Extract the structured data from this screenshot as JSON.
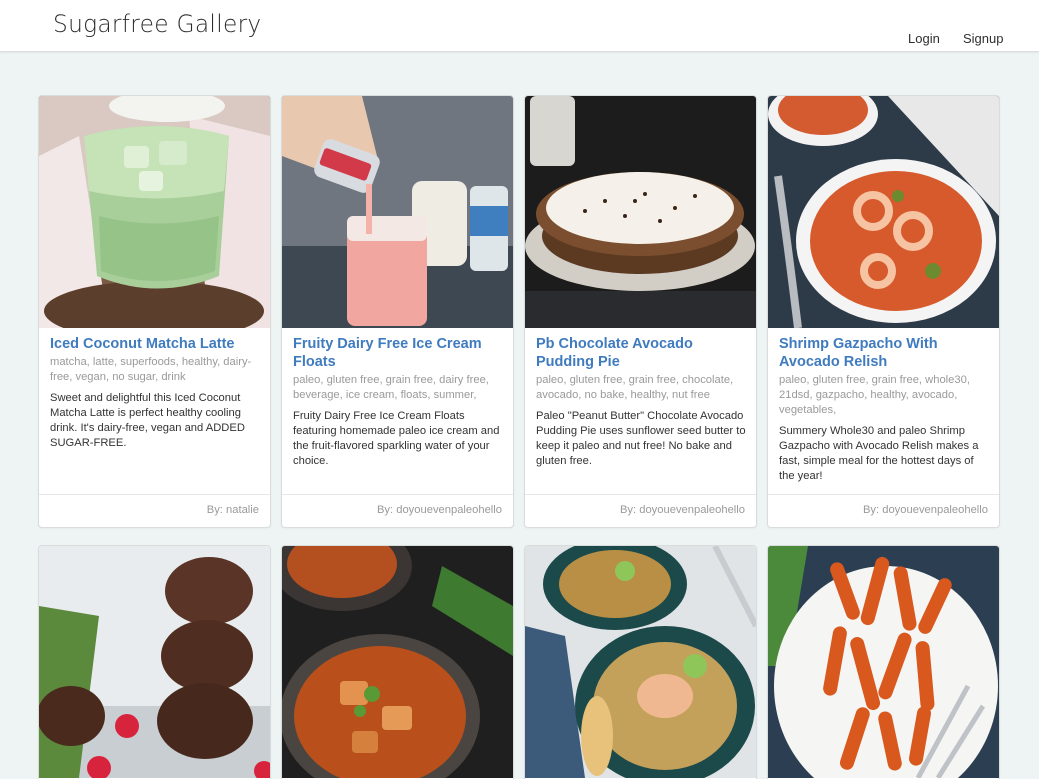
{
  "header": {
    "brand": "Sugarfree Gallery",
    "login": "Login",
    "signup": "Signup"
  },
  "cards": [
    {
      "title": "Iced Coconut Matcha Latte",
      "tags": "matcha, latte, superfoods, healthy, dairy-free, vegan, no sugar, drink",
      "description": "Sweet and delightful this Iced Coconut Matcha Latte is perfect healthy cooling drink. It's dairy-free, vegan and ADDED SUGAR-FREE.",
      "author": "By: natalie"
    },
    {
      "title": "Fruity Dairy Free Ice Cream Floats",
      "tags": "paleo, gluten free, grain free, dairy free, beverage, ice cream, floats, summer,",
      "description": "Fruity Dairy Free Ice Cream Floats featuring homemade paleo ice cream and the fruit-flavored sparkling water of your choice.",
      "author": "By: doyouevenpaleohello"
    },
    {
      "title": "Pb Chocolate Avocado Pudding Pie",
      "tags": "paleo, gluten free, grain free, chocolate, avocado, no bake, healthy, nut free",
      "description": "Paleo \"Peanut Butter\" Chocolate Avocado Pudding Pie uses sunflower seed butter to keep it paleo and nut free! No bake and gluten free.",
      "author": "By: doyouevenpaleohello"
    },
    {
      "title": "Shrimp Gazpacho With Avocado Relish",
      "tags": "paleo, gluten free, grain free, whole30, 21dsd, gazpacho, healthy, avocado, vegetables,",
      "description": "Summery Whole30 and paleo Shrimp Gazpacho with Avocado Relish makes a fast, simple meal for the hottest days of the year!",
      "author": "By: doyouevenpaleohello"
    }
  ],
  "colors": {
    "background": "#eef4f3",
    "title_link": "#3f7bbf",
    "muted_text": "#9a9a9a"
  }
}
